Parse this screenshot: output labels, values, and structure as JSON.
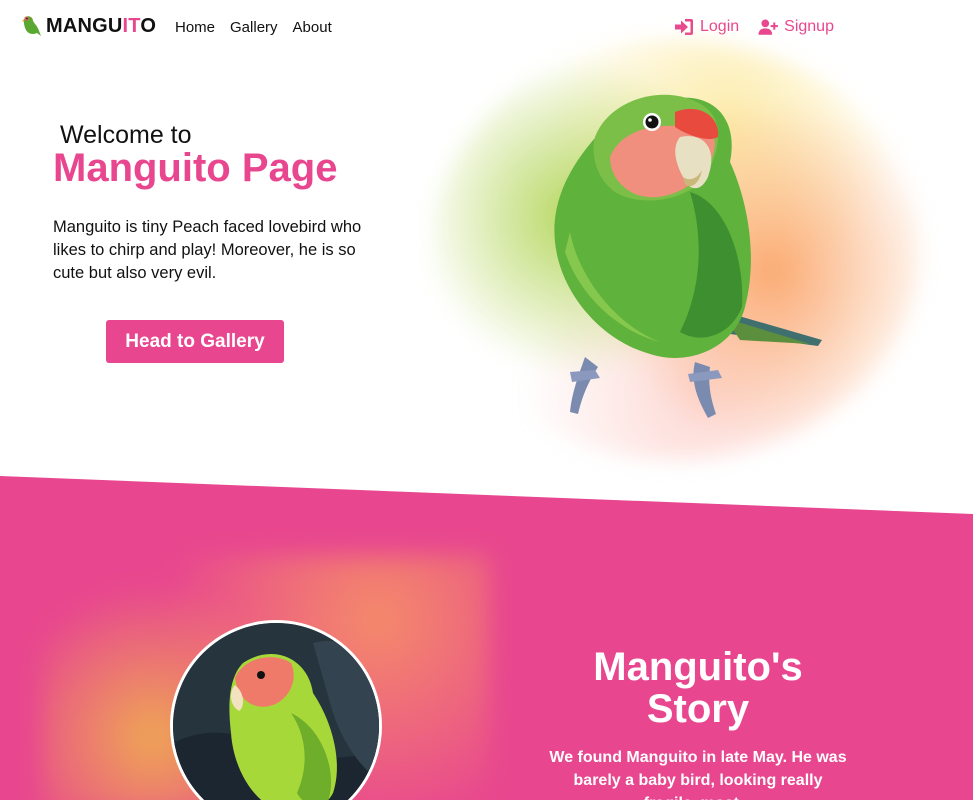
{
  "brand": {
    "text_a": "MANGU",
    "text_b": "IT",
    "text_c": "O"
  },
  "nav": {
    "links": [
      "Home",
      "Gallery",
      "About"
    ]
  },
  "auth": {
    "login_label": "Login",
    "signup_label": "Signup"
  },
  "hero": {
    "welcome": "Welcome to",
    "title": "Manguito Page",
    "description": "Manguito is tiny Peach faced lovebird who likes to chirp and play! Moreover, he is so cute but also very evil.",
    "cta_label": "Head to Gallery"
  },
  "story": {
    "title_line1": "Manguito's",
    "title_line2": "Story",
    "text": "We found Manguito in late May. He was barely a baby bird, looking really fragile, most..."
  },
  "colors": {
    "accent": "#e8478f",
    "pink_section": "#e8478f"
  }
}
